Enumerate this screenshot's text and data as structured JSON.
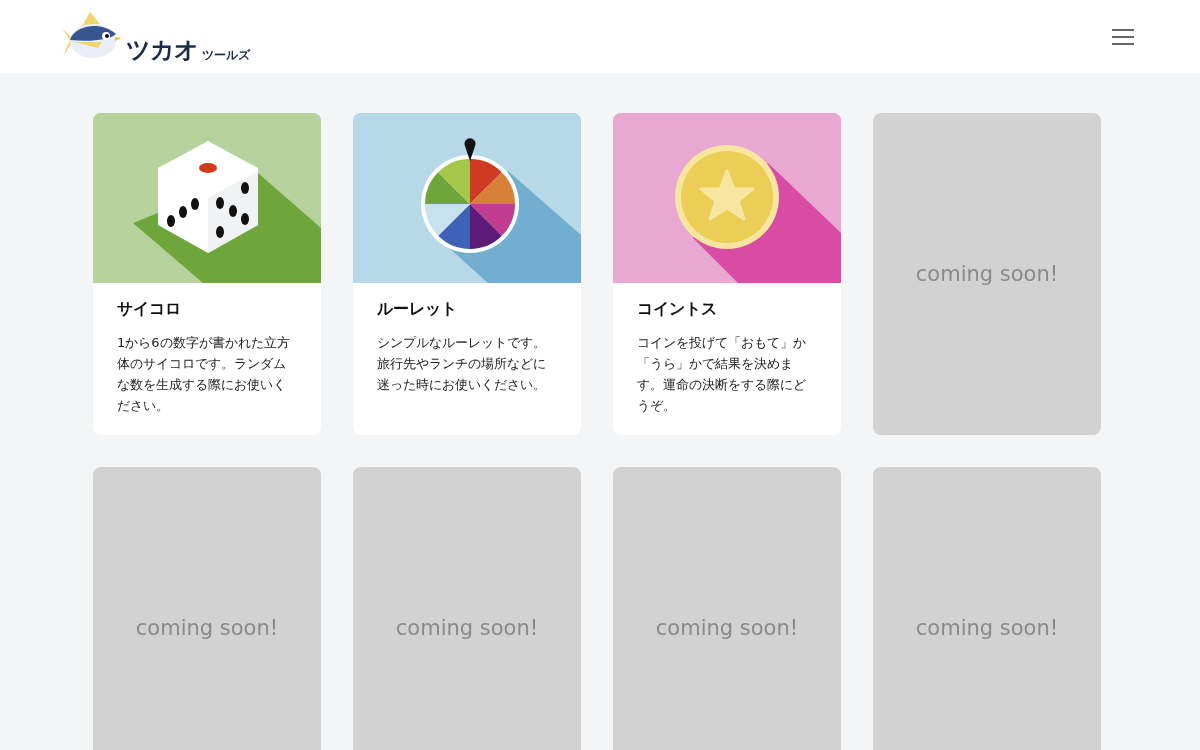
{
  "header": {
    "logo": {
      "main": "ツカオ",
      "sub": "ツールズ"
    }
  },
  "cards": [
    {
      "kind": "tool",
      "illustration": {
        "kind": "dice"
      },
      "title": "サイコロ",
      "description": "1から6の数字が書かれた立方体のサイコロです。ランダムな数を生成する際にお使いください。"
    },
    {
      "kind": "tool",
      "illustration": {
        "kind": "roulette"
      },
      "title": "ルーレット",
      "description": "シンプルなルーレットです。旅行先やランチの場所などに迷った時にお使いください。"
    },
    {
      "kind": "tool",
      "illustration": {
        "kind": "coin"
      },
      "title": "コイントス",
      "description": "コインを投げて「おもて」か「うら」かで結果を決めます。運命の決断をする際にどうぞ。"
    },
    {
      "kind": "soon",
      "label": "coming soon!"
    },
    {
      "kind": "soon",
      "label": "coming soon!"
    },
    {
      "kind": "soon",
      "label": "coming soon!"
    },
    {
      "kind": "soon",
      "label": "coming soon!"
    },
    {
      "kind": "soon",
      "label": "coming soon!"
    }
  ]
}
